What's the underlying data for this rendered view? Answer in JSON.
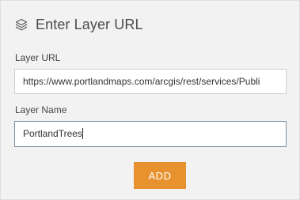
{
  "header": {
    "icon": "layers-icon",
    "title": "Enter Layer URL"
  },
  "form": {
    "url_label": "Layer URL",
    "url_value": "https://www.portlandmaps.com/arcgis/rest/services/Publi",
    "name_label": "Layer Name",
    "name_value": "PortlandTrees"
  },
  "actions": {
    "add_label": "ADD"
  },
  "colors": {
    "panel_bg": "#f2f2f2",
    "accent": "#e8922f",
    "focused_border": "#7a8ea6"
  }
}
